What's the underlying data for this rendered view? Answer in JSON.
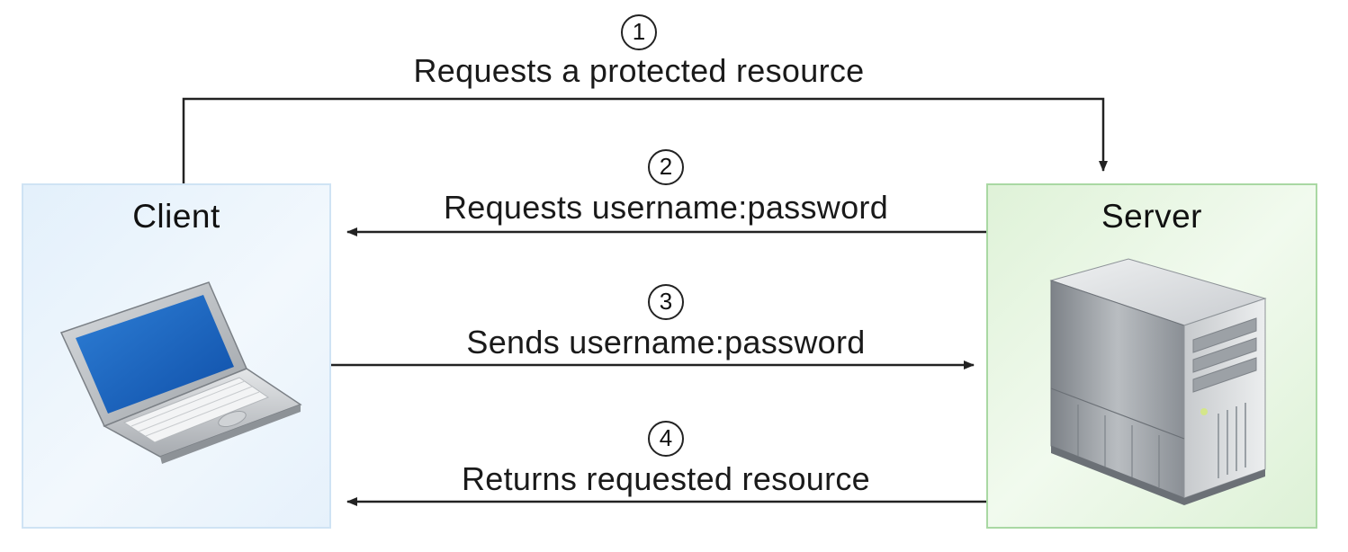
{
  "client": {
    "title": "Client"
  },
  "server": {
    "title": "Server"
  },
  "steps": [
    {
      "number": "1",
      "label": "Requests a protected resource",
      "direction": "client-to-server"
    },
    {
      "number": "2",
      "label": "Requests username:password",
      "direction": "server-to-client"
    },
    {
      "number": "3",
      "label": "Sends username:password",
      "direction": "client-to-server"
    },
    {
      "number": "4",
      "label": "Returns requested resource",
      "direction": "server-to-client"
    }
  ],
  "icons": {
    "client": "laptop-icon",
    "server": "server-tower-icon"
  },
  "colors": {
    "client_fill": "#e3f0fb",
    "client_border": "#cfe3f4",
    "server_fill": "#dff2d8",
    "server_border": "#a9d8a3",
    "arrow": "#222222"
  }
}
